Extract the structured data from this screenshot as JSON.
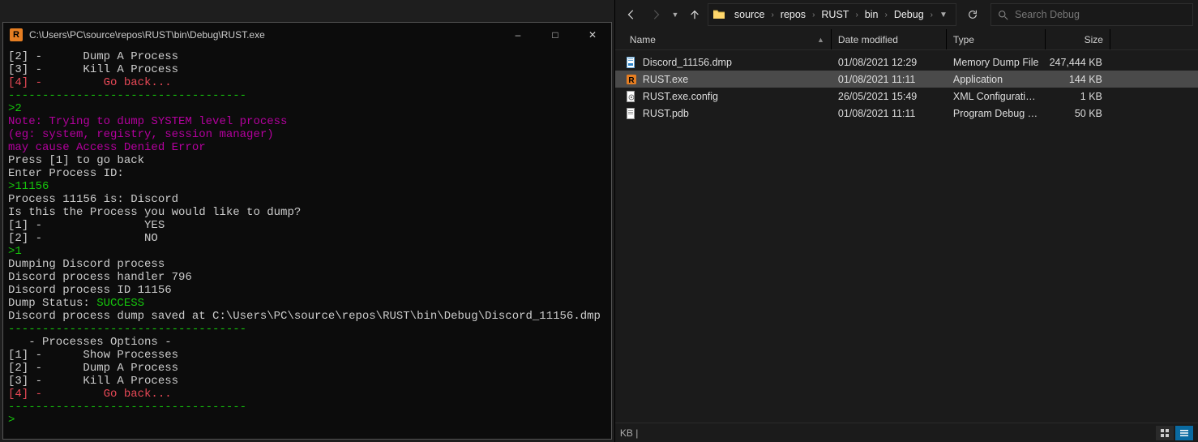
{
  "console": {
    "title": "C:\\Users\\PC\\source\\repos\\RUST\\bin\\Debug\\RUST.exe",
    "icon_letter": "R",
    "lines": [
      {
        "cls": "c-white",
        "text": "[2] -      Dump A Process"
      },
      {
        "cls": "c-white",
        "text": "[3] -      Kill A Process"
      },
      {
        "cls": "c-red",
        "text": "[4] -         Go back..."
      },
      {
        "cls": "c-dash",
        "text": "-----------------------------------"
      },
      {
        "cls": "c-green",
        "text": ">2"
      },
      {
        "cls": "c-magenta",
        "text": "Note: Trying to dump SYSTEM level process"
      },
      {
        "cls": "c-magenta",
        "text": "(eg: system, registry, session manager)"
      },
      {
        "cls": "c-magenta",
        "text": "may cause Access Denied Error"
      },
      {
        "cls": "c-white",
        "text": "Press [1] to go back"
      },
      {
        "cls": "c-white",
        "text": "Enter Process ID:"
      },
      {
        "cls": "c-green",
        "text": ">11156"
      },
      {
        "cls": "c-white",
        "text": "Process 11156 is: Discord"
      },
      {
        "cls": "c-white",
        "text": "Is this the Process you would like to dump?"
      },
      {
        "cls": "c-white",
        "text": "[1] -               YES"
      },
      {
        "cls": "c-white",
        "text": "[2] -               NO"
      },
      {
        "cls": "c-green",
        "text": ">1"
      },
      {
        "cls": "c-white",
        "text": "Dumping Discord process"
      },
      {
        "cls": "c-white",
        "text": "Discord process handler 796"
      },
      {
        "cls": "c-white",
        "text": "Discord process ID 11156"
      },
      {
        "cls": "mixed",
        "parts": [
          {
            "cls": "c-white",
            "text": "Dump Status: "
          },
          {
            "cls": "c-green",
            "text": "SUCCESS"
          }
        ]
      },
      {
        "cls": "c-white",
        "text": "Discord process dump saved at C:\\Users\\PC\\source\\repos\\RUST\\bin\\Debug\\Discord_11156.dmp"
      },
      {
        "cls": "c-dash",
        "text": "-----------------------------------"
      },
      {
        "cls": "c-white",
        "text": "   - Processes Options -"
      },
      {
        "cls": "c-white",
        "text": ""
      },
      {
        "cls": "c-white",
        "text": "[1] -      Show Processes"
      },
      {
        "cls": "c-white",
        "text": "[2] -      Dump A Process"
      },
      {
        "cls": "c-white",
        "text": "[3] -      Kill A Process"
      },
      {
        "cls": "c-red",
        "text": "[4] -         Go back..."
      },
      {
        "cls": "c-dash",
        "text": "-----------------------------------"
      },
      {
        "cls": "c-green",
        "text": ">"
      }
    ]
  },
  "explorer": {
    "breadcrumb": [
      "source",
      "repos",
      "RUST",
      "bin",
      "Debug"
    ],
    "search_placeholder": "Search Debug",
    "columns": {
      "name": "Name",
      "date": "Date modified",
      "type": "Type",
      "size": "Size"
    },
    "files": [
      {
        "icon": "dmp",
        "name": "Discord_11156.dmp",
        "date": "01/08/2021 12:29",
        "type": "Memory Dump File",
        "size": "247,444 KB",
        "selected": false
      },
      {
        "icon": "exe",
        "name": "RUST.exe",
        "date": "01/08/2021 11:11",
        "type": "Application",
        "size": "144 KB",
        "selected": true
      },
      {
        "icon": "cfg",
        "name": "RUST.exe.config",
        "date": "26/05/2021 15:49",
        "type": "XML Configuratio...",
        "size": "1 KB",
        "selected": false
      },
      {
        "icon": "pdb",
        "name": "RUST.pdb",
        "date": "01/08/2021 11:11",
        "type": "Program Debug D...",
        "size": "50 KB",
        "selected": false
      }
    ],
    "status_left": "  KB  |"
  }
}
